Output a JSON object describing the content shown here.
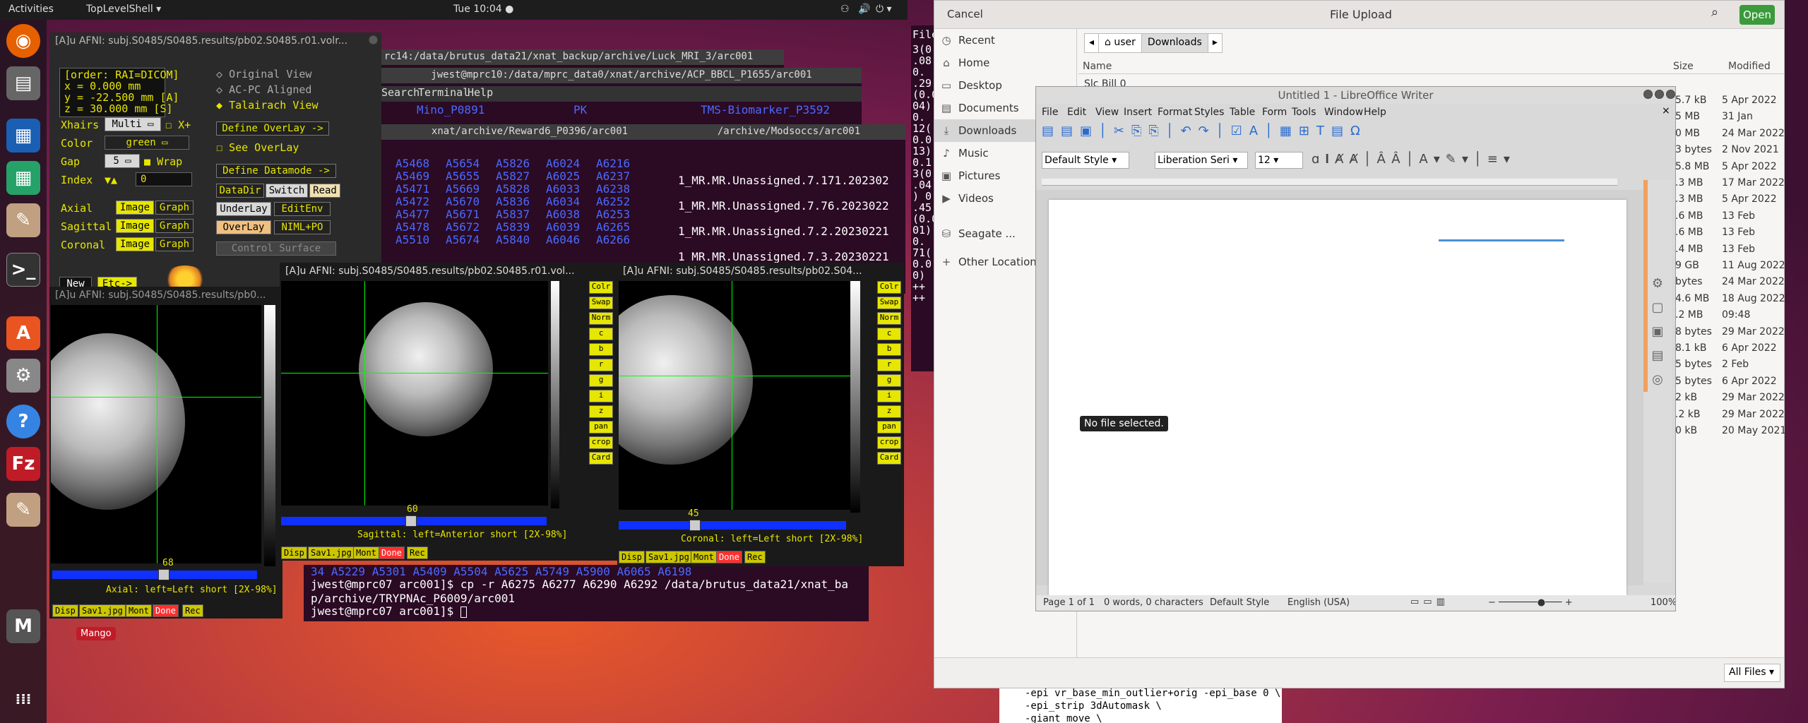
{
  "topbar": {
    "activities": "Activities",
    "app": "TopLevelShell",
    "clock": "Tue 10:04"
  },
  "afni_ctrl": {
    "title": "[A]u AFNI: subj.S0485/S0485.results/pb02.S0485.r01.volr...",
    "coords": [
      "[order: RAI=DICOM]",
      "x =     0.000 mm",
      "y =   -22.500 mm [A]",
      "z =    30.000 mm [S]"
    ],
    "xhairs_label": "Xhairs",
    "xhairs_value": "Multi",
    "xplus": "X+",
    "color_label": "Color",
    "color_value": "green",
    "gap_label": "Gap",
    "gap_value": "5",
    "wrap": "Wrap",
    "index_label": "Index",
    "index_value": "0",
    "views": [
      "Axial",
      "Sagittal",
      "Coronal"
    ],
    "image": "Image",
    "graph": "Graph",
    "orig_view": "Original View",
    "acpc": "AC-PC Aligned",
    "talairach": "Talairach View",
    "define_overlay": "Define OverLay ->",
    "see_overlay": "See OverLay",
    "define_datamode": "Define Datamode ->",
    "datadir": "DataDir",
    "switch": "Switch",
    "read": "Read",
    "underlay": "UnderLay",
    "editenv": "EditEnv",
    "overlay": "OverLay",
    "nimlpo": "NIML+PO",
    "control_surface": "Control Surface",
    "new": "New",
    "etc": "Etc->"
  },
  "terminals": {
    "t1_title": "rc14:/data/brutus_data21/xnat_backup/archive/Luck_MRI_3/arc001",
    "t2_title": "jwest@mprc10:/data/mprc_data0/xnat/archive/ACP_BBCL_P1655/arc001",
    "t2_menu": [
      "Search",
      "Terminal",
      "Help"
    ],
    "t2_line": [
      "Mino_P0891",
      "PK",
      "TMS-Biomarker_P3592"
    ],
    "t3_title": "xnat/archive/Reward6_P0396/arc001",
    "t3_cols": [
      [
        "A5468",
        "A5654",
        "A5826",
        "A6024",
        "A6216"
      ],
      [
        "A5469",
        "A5655",
        "A5827",
        "A6025",
        "A6237"
      ],
      [
        "A5471",
        "A5669",
        "A5828",
        "A6033",
        "A6238"
      ],
      [
        "A5472",
        "A5670",
        "A5836",
        "A6034",
        "A6252"
      ],
      [
        "A5477",
        "A5671",
        "A5837",
        "A6038",
        "A6253"
      ],
      [
        "A5478",
        "A5672",
        "A5839",
        "A6039",
        "A6265"
      ],
      [
        "A5510",
        "A5674",
        "A5840",
        "A6046",
        "A6266"
      ]
    ],
    "t4_title": "/archive/Modsoccs/arc001",
    "t4_lines": [
      "1_MR.MR.Unassigned.7.171.202302",
      "1_MR.MR.Unassigned.7.76.2023022",
      "1_MR.MR.Unassigned.7.2.20230221",
      "1_MR.MR.Unassigned.7.3.20230221"
    ],
    "t5_lines": [
      "34  A5229  A5301  A5409  A5504  A5625  A5749  A5900  A6065  A6198",
      "jwest@mprc07 arc001]$ cp -r A6275 A6277 A6290 A6292 /data/brutus_data21/xnat_ba",
      "p/archive/TRYPNAc_P6009/arc001",
      "jwest@mprc07 arc001]$ "
    ],
    "t6_lines": [
      "3(0",
      ".08",
      "0.",
      ".29",
      "(0.0",
      "04)",
      "0.",
      "12(",
      "0.0",
      "13)",
      "0.1",
      "3(0",
      ".04",
      ") 0",
      ".45",
      "(0.0",
      "01)",
      "0.",
      "71(",
      "0.0",
      "0)",
      "++",
      "++"
    ],
    "t6_label": "File",
    "bottom_lines": [
      "-epi vr_base_min_outlier+orig -epi_base 0 \\",
      "-epi_strip 3dAutomask              \\",
      "-giant_move                       \\"
    ]
  },
  "afni_axial": {
    "title": "[A]u AFNI: subj.S0485/S0485.results/pb0...",
    "slice": "68",
    "caption": "Axial: left=Left short [2X-98%]"
  },
  "afni_sag": {
    "title": "[A]u AFNI: subj.S0485/S0485.results/pb02.S0485.r01.vol...",
    "slice": "60",
    "caption": "Sagittal: left=Anterior short [2X-98%]"
  },
  "afni_cor": {
    "title": "[A]u AFNI: subj.S0485/S0485.results/pb02.S04...",
    "slice": "45",
    "caption": "Coronal: left=Left short [2X-98%]"
  },
  "img_buttons": {
    "disp": "Disp",
    "sav": "Sav1.jpg",
    "mont": "Mont",
    "done": "Done",
    "rec": "Rec"
  },
  "img_side": [
    "Colr",
    "Swap",
    "Norm",
    "c",
    "b",
    "r",
    "g",
    "i",
    "z",
    "pan",
    "crop",
    "Card"
  ],
  "mango": "Mango",
  "file_upload": {
    "title": "File Upload",
    "cancel": "Cancel",
    "open": "Open",
    "path": [
      "user",
      "Downloads"
    ],
    "sidebar": [
      "Recent",
      "Home",
      "Desktop",
      "Documents",
      "Downloads",
      "Music",
      "Pictures",
      "Videos",
      "Seagate ...",
      "Other Locations"
    ],
    "cols": {
      "name": "Name",
      "size": "Size",
      "modified": "Modified"
    },
    "first_file": "Slc Bill 0",
    "rows": [
      {
        "size": "5.7 kB",
        "mod": "5 Apr 2022"
      },
      {
        "size": "5 MB",
        "mod": "31 Jan"
      },
      {
        "size": "0 MB",
        "mod": "24 Mar 2022"
      },
      {
        "size": "3 bytes",
        "mod": "2 Nov 2021"
      },
      {
        "size": "5.8 MB",
        "mod": "5 Apr 2022"
      },
      {
        "size": ".3 MB",
        "mod": "17 Mar 2022"
      },
      {
        "size": ".3 MB",
        "mod": "5 Apr 2022"
      },
      {
        "size": ".6 MB",
        "mod": "13 Feb"
      },
      {
        "size": ".6 MB",
        "mod": "13 Feb"
      },
      {
        "size": ".4 MB",
        "mod": "13 Feb"
      },
      {
        "size": "9 GB",
        "mod": "11 Aug 2022"
      },
      {
        "size": "bytes",
        "mod": "24 Mar 2022"
      },
      {
        "size": "4.6 MB",
        "mod": "18 Aug 2022"
      },
      {
        "size": ".2 MB",
        "mod": "09:48"
      },
      {
        "size": "8 bytes",
        "mod": "29 Mar 2022"
      },
      {
        "size": "8.1 kB",
        "mod": "6 Apr 2022"
      },
      {
        "size": "5 bytes",
        "mod": "2 Feb"
      },
      {
        "size": "5 bytes",
        "mod": "6 Apr 2022"
      },
      {
        "size": "2 kB",
        "mod": "29 Mar 2022"
      },
      {
        "size": ".2 kB",
        "mod": "29 Mar 2022"
      },
      {
        "size": "0 kB",
        "mod": "20 May 2021"
      }
    ],
    "filter": "All Files"
  },
  "writer": {
    "title": "Untitled 1 - LibreOffice Writer",
    "menu": [
      "File",
      "Edit",
      "View",
      "Insert",
      "Format",
      "Styles",
      "Table",
      "Form",
      "Tools",
      "Window",
      "Help"
    ],
    "style": "Default Style",
    "font": "Liberation Seri",
    "size": "12",
    "tooltip": "No file selected.",
    "status": {
      "page": "Page 1 of 1",
      "words": "0 words, 0 characters",
      "style": "Default Style",
      "lang": "English (USA)",
      "zoom": "100%"
    }
  }
}
